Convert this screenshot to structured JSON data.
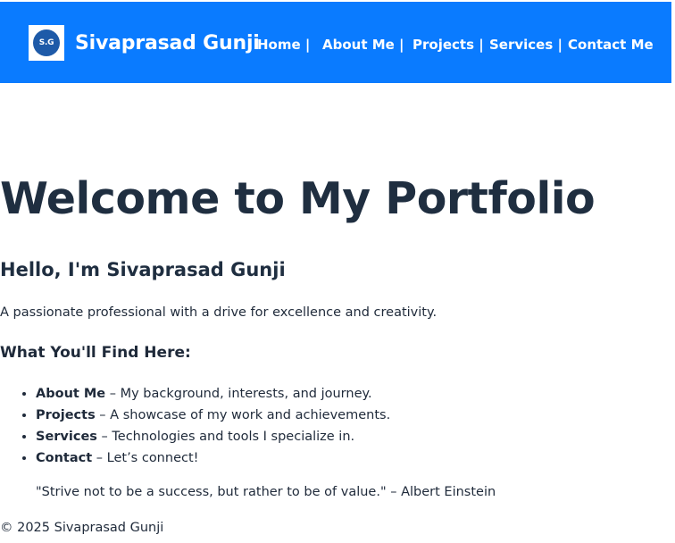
{
  "header": {
    "logo_text": "S.G",
    "brand": "Sivaprasad Gunji",
    "nav": [
      {
        "label": "Home |"
      },
      {
        "label": "About Me |"
      },
      {
        "label": "Projects |"
      },
      {
        "label": "Services |"
      },
      {
        "label": "Contact Me"
      }
    ],
    "colors": {
      "bar": "#0a7bff",
      "logo_circle": "#1e5aa8",
      "text": "#ffffff"
    }
  },
  "main": {
    "title": "Welcome to My Portfolio",
    "greeting": "Hello, I'm Sivaprasad Gunji",
    "tagline": "A passionate professional with a drive for excellence and creativity.",
    "find_heading": "What You'll Find Here:",
    "features": [
      {
        "term": "About Me",
        "desc": " – My background, interests, and journey."
      },
      {
        "term": "Projects",
        "desc": " – A showcase of my work and achievements."
      },
      {
        "term": "Services",
        "desc": " – Technologies and tools I specialize in."
      },
      {
        "term": "Contact",
        "desc": " – Let’s connect!"
      }
    ],
    "quote": "\"Strive not to be a success, but rather to be of value.\" – Albert Einstein"
  },
  "footer": {
    "copyright": "© 2025 Sivaprasad Gunji"
  }
}
